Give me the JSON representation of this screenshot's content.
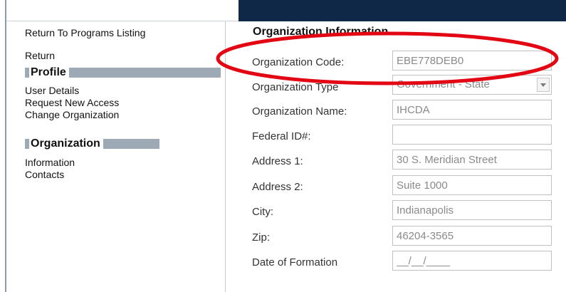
{
  "sidebar": {
    "return_to_listing": "Return To Programs Listing",
    "return": "Return",
    "profile_header": "Profile",
    "profile_items": [
      "User Details",
      "Request New Access",
      "Change Organization"
    ],
    "organization_header": "Organization",
    "organization_items": [
      "Information",
      "Contacts"
    ]
  },
  "main": {
    "title": "Organization Information",
    "fields": {
      "org_code": {
        "label": "Organization Code:",
        "value": "EBE778DEB0"
      },
      "org_type": {
        "label": "Organization Type",
        "value": "Government - State"
      },
      "org_name": {
        "label": "Organization Name:",
        "value": "IHCDA"
      },
      "federal_id": {
        "label": "Federal ID#:",
        "value": ""
      },
      "address1": {
        "label": "Address 1:",
        "value": "30 S. Meridian Street"
      },
      "address2": {
        "label": "Address 2:",
        "value": "Suite 1000"
      },
      "city": {
        "label": "City:",
        "value": "Indianapolis"
      },
      "zip": {
        "label": "Zip:",
        "value": "46204-3565"
      },
      "date_formation": {
        "label": "Date of Formation",
        "value": "__/__/____"
      }
    }
  },
  "colors": {
    "header_navy": "#0f2847",
    "section_bar": "#9ea9b6",
    "annotation_red": "#e30613",
    "field_text": "#8a8a8a"
  },
  "icons": {
    "select_arrow": "chevron-down-icon"
  }
}
